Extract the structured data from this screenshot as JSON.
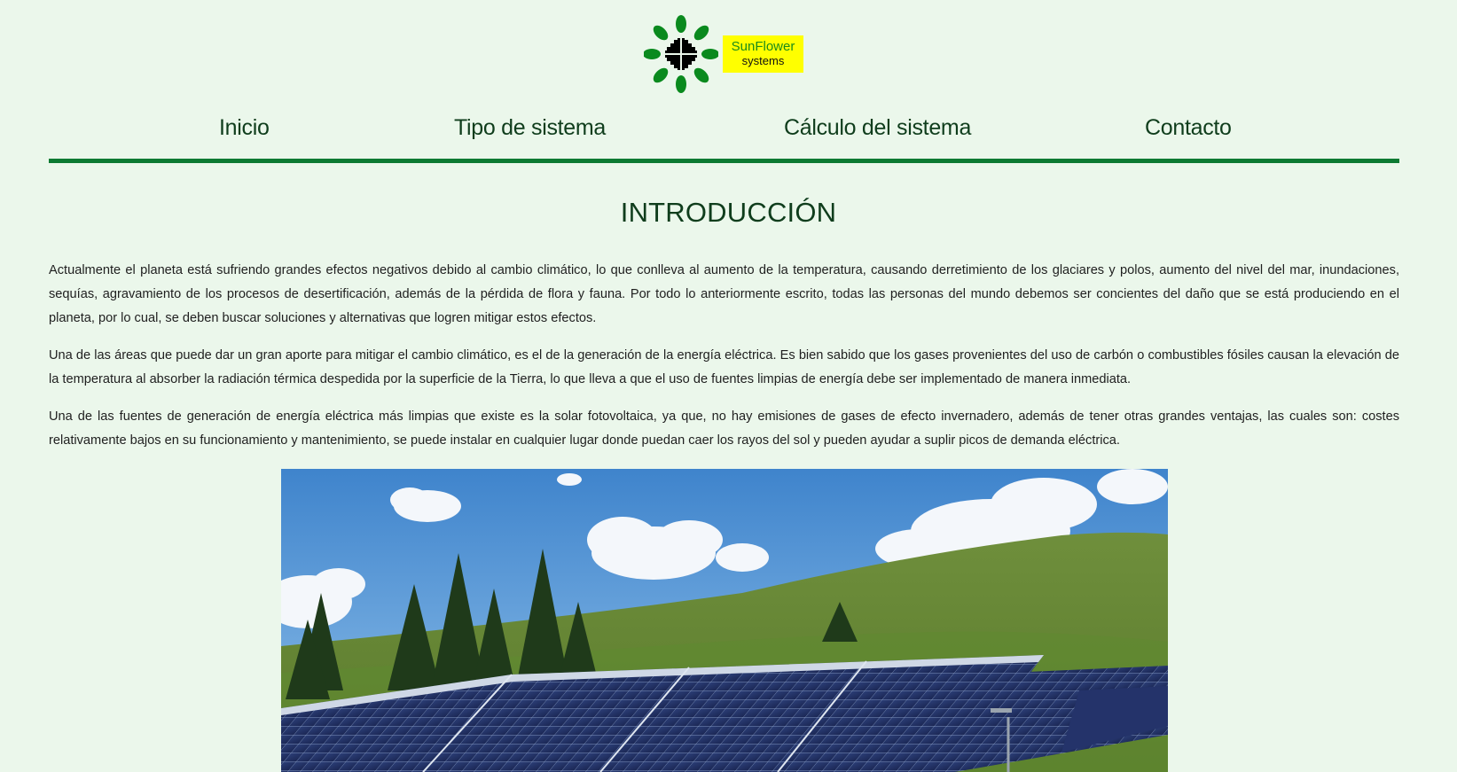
{
  "logo": {
    "brand_line1": "SunFlower",
    "brand_line2": "systems",
    "colors": {
      "leaf": "#0a8a1e",
      "badge": "#ffff00",
      "center": "#000000"
    }
  },
  "nav": {
    "items": [
      {
        "label": "Inicio"
      },
      {
        "label": "Tipo de sistema"
      },
      {
        "label": "Cálculo del sistema"
      },
      {
        "label": "Contacto"
      }
    ],
    "rule_color": "#0c7a32"
  },
  "main": {
    "title": "INTRODUCCIÓN",
    "paragraphs": [
      "Actualmente el planeta está sufriendo grandes efectos negativos debido al cambio climático, lo que conlleva al aumento de la temperatura, causando derretimiento de los glaciares y polos, aumento del nivel del mar, inundaciones, sequías, agravamiento de los procesos de desertificación, además de la pérdida de flora y fauna. Por todo lo anteriormente escrito, todas las personas del mundo debemos ser concientes del daño que se está produciendo en el planeta, por lo cual, se deben buscar soluciones y alternativas que logren mitigar estos efectos.",
      "Una de las áreas que puede dar un gran aporte para mitigar el cambio climático, es el de la generación de la energía eléctrica. Es bien sabido que los gases provenientes del uso de carbón o combustibles fósiles causan la elevación de la temperatura al absorber la radiación térmica despedida por la superficie de la Tierra, lo que lleva a que el uso de fuentes limpias de energía debe ser implementado de manera inmediata.",
      "Una de las fuentes de generación de energía eléctrica más limpias que existe es la solar fotovoltaica, ya que, no hay emisiones de gases de efecto invernadero, además de tener otras grandes ventajas, las cuales son: costes relativamente bajos en su funcionamiento y mantenimiento, se puede instalar en cualquier lugar donde puedan caer los rayos del sol y pueden ayudar a suplir picos de demanda eléctrica."
    ]
  },
  "colors": {
    "background": "#ebf7eb",
    "heading": "#0f3d1c"
  }
}
